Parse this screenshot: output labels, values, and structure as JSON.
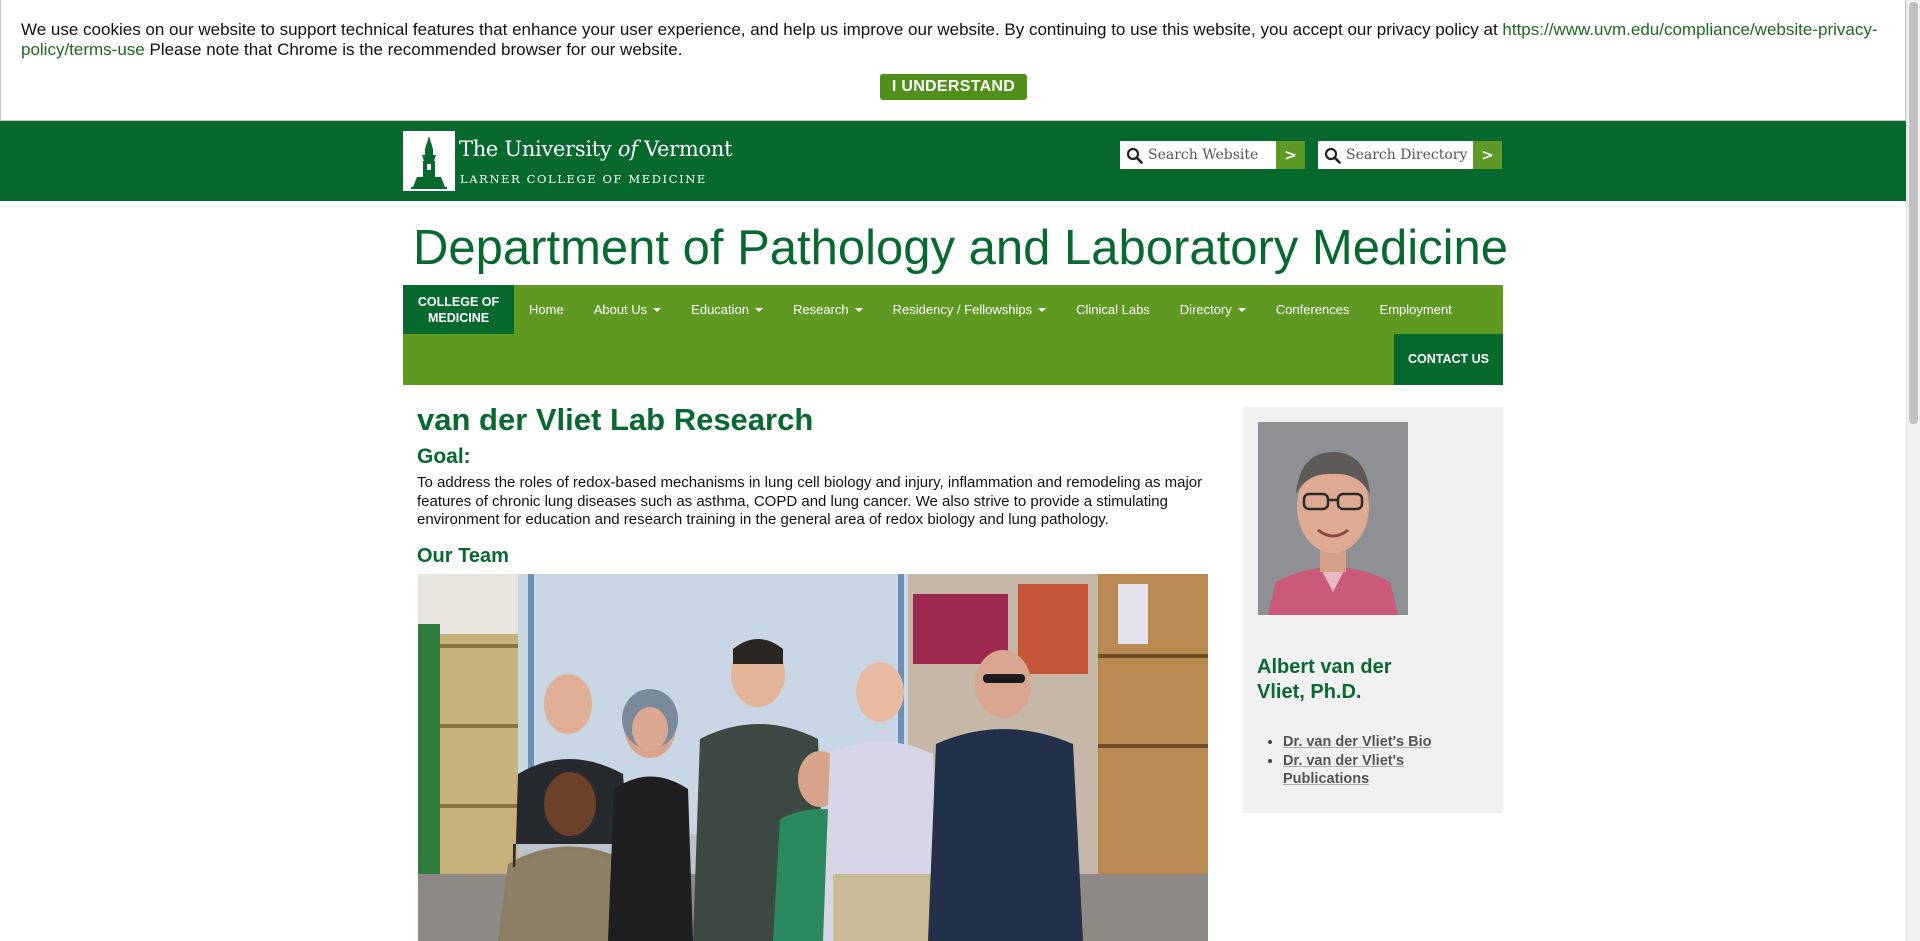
{
  "cookie_banner": {
    "text": "We use cookies on our website to support technical features that enhance your user experience, and help us improve our website. By continuing to use this website, you accept our privacy policy at ",
    "link": "https://www.uvm.edu/compliance/website-privacy-policy/terms-use",
    "note": " Please note that Chrome is the recommended browser for our website.",
    "button_label": "I UNDERSTAND"
  },
  "header": {
    "logo_title_pre": "The University ",
    "logo_title_of": "of",
    "logo_title_post": " Vermont",
    "logo_subtitle": "LARNER COLLEGE OF MEDICINE",
    "search_website_placeholder": "Search Website",
    "search_directory_placeholder": "Search Directory",
    "search_go_label": ">"
  },
  "page_title": "Department of Pathology and Laboratory Medicine",
  "nav": {
    "college_line1": "COLLEGE OF",
    "college_line2": "MEDICINE",
    "items": [
      {
        "label": "Home",
        "dropdown": false
      },
      {
        "label": "About Us",
        "dropdown": true
      },
      {
        "label": "Education",
        "dropdown": true
      },
      {
        "label": "Research",
        "dropdown": true
      },
      {
        "label": "Residency / Fellowships",
        "dropdown": true
      },
      {
        "label": "Clinical Labs",
        "dropdown": false
      },
      {
        "label": "Directory",
        "dropdown": true
      },
      {
        "label": "Conferences",
        "dropdown": false
      },
      {
        "label": "Employment",
        "dropdown": false
      }
    ],
    "contact_label": "CONTACT US"
  },
  "main": {
    "title": "van der Vliet Lab Research",
    "goal_heading": "Goal:",
    "goal_text": "To address the roles of redox-based mechanisms in lung cell biology and injury, inflammation and remodeling as major features of chronic lung diseases such as asthma, COPD and lung cancer. We also strive to provide a stimulating environment for education and research training in the general area of redox biology and lung pathology.",
    "team_heading": "Our Team"
  },
  "sidebar": {
    "name": "Albert van der Vliet, Ph.D.",
    "links": [
      "Dr. van der Vliet's Bio",
      "Dr. van der Vliet's Publications"
    ]
  },
  "colors": {
    "brand_green": "#07692e",
    "nav_green": "#5e9921",
    "button_green": "#4f8f1a"
  }
}
